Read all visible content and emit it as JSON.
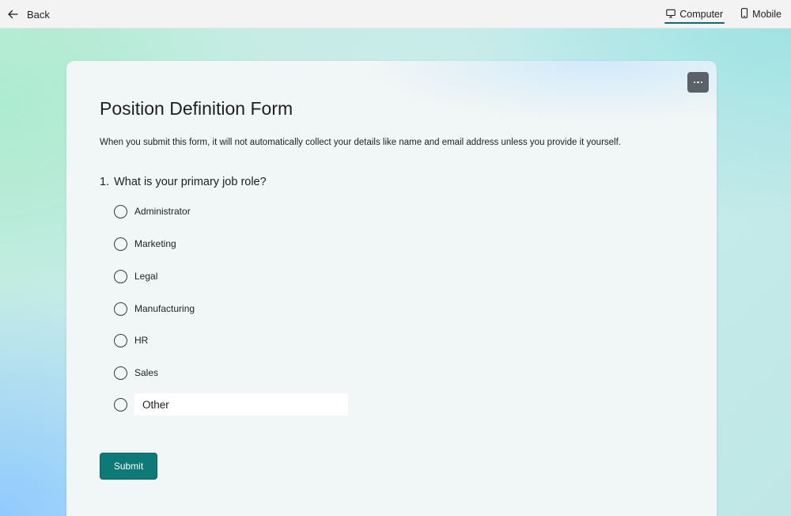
{
  "topbar": {
    "back_label": "Back",
    "back_icon": "arrow-left-icon",
    "tabs": [
      {
        "label": "Computer",
        "icon": "monitor-icon",
        "active": true
      },
      {
        "label": "Mobile",
        "icon": "phone-icon",
        "active": false
      }
    ],
    "active_tab_underline_color": "#0f6b6b"
  },
  "form": {
    "menu_icon": "more-horizontal-icon",
    "title": "Position Definition Form",
    "description": "When you submit this form, it will not automatically collect your details like name and email address unless you provide it yourself.",
    "question": {
      "number": "1.",
      "text": "What is your primary job role?",
      "options": [
        "Administrator",
        "Marketing",
        "Legal",
        "Manufacturing",
        "HR",
        "Sales"
      ],
      "other_value": "Other"
    },
    "submit_label": "Submit",
    "accent_color": "#0d7a78"
  }
}
